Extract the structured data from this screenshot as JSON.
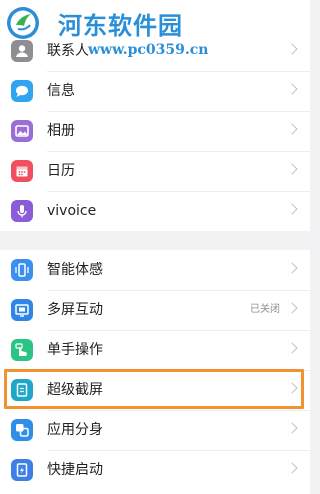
{
  "watermark": {
    "title": "河东软件园",
    "url": "www.pc0359.cn"
  },
  "settings_group_1": [
    {
      "label": "联系人",
      "icon": "contacts-icon",
      "color": "#8e8e93"
    },
    {
      "label": "信息",
      "icon": "messages-icon",
      "color": "#2fa4ef"
    },
    {
      "label": "相册",
      "icon": "album-icon",
      "color": "#9a6ed6"
    },
    {
      "label": "日历",
      "icon": "calendar-icon",
      "color": "#ef4f5e"
    },
    {
      "label": "vivoice",
      "icon": "microphone-icon",
      "color": "#8a5cd8"
    }
  ],
  "settings_group_2": [
    {
      "label": "智能体感",
      "icon": "motion-icon",
      "color": "#3a8ff0",
      "status": ""
    },
    {
      "label": "多屏互动",
      "icon": "multiscreen-icon",
      "color": "#2f86e8",
      "status": "已关闭"
    },
    {
      "label": "单手操作",
      "icon": "one-hand-icon",
      "color": "#2cc486",
      "status": ""
    },
    {
      "label": "超级截屏",
      "icon": "screenshot-icon",
      "color": "#1fa7c9",
      "status": ""
    },
    {
      "label": "应用分身",
      "icon": "app-clone-icon",
      "color": "#2f8ee8",
      "status": ""
    },
    {
      "label": "快捷启动",
      "icon": "quick-launch-icon",
      "color": "#3c7fe6",
      "status": ""
    }
  ],
  "highlight_color": "#f29231"
}
